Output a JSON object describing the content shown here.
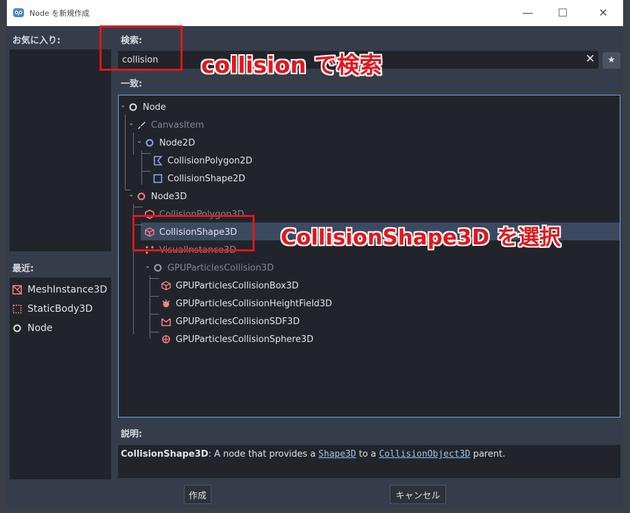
{
  "window": {
    "title": "Node を新規作成",
    "controls": {
      "minimize": "—",
      "maximize": "☐",
      "close": "✕"
    }
  },
  "favorites": {
    "label": "お気に入り:"
  },
  "recent": {
    "label": "最近:",
    "items": [
      {
        "label": "MeshInstance3D",
        "icon": "mesh-instance-icon"
      },
      {
        "label": "StaticBody3D",
        "icon": "static-body-icon"
      },
      {
        "label": "Node",
        "icon": "node-icon"
      }
    ]
  },
  "search": {
    "label": "検索:",
    "value": "collision",
    "clear": "✕",
    "favorite": "★"
  },
  "matches": {
    "label": "一致:",
    "tree": [
      {
        "label": "Node",
        "icon": "node-icon",
        "dim": false
      },
      {
        "label": "CanvasItem",
        "icon": "canvas-item-icon",
        "dim": true
      },
      {
        "label": "Node2D",
        "icon": "node2d-icon",
        "dim": false
      },
      {
        "label": "CollisionPolygon2D",
        "icon": "collision-polygon-2d-icon",
        "dim": false
      },
      {
        "label": "CollisionShape2D",
        "icon": "collision-shape-2d-icon",
        "dim": false
      },
      {
        "label": "Node3D",
        "icon": "node3d-icon",
        "dim": false
      },
      {
        "label": "CollisionPolygon3D",
        "icon": "collision-polygon-3d-icon",
        "dim": false
      },
      {
        "label": "CollisionShape3D",
        "icon": "collision-shape-3d-icon",
        "dim": false,
        "selected": true
      },
      {
        "label": "VisualInstance3D",
        "icon": "visual-instance-icon",
        "dim": true
      },
      {
        "label": "GPUParticlesCollision3D",
        "icon": "gpu-particles-collision-icon",
        "dim": true
      },
      {
        "label": "GPUParticlesCollisionBox3D",
        "icon": "gpu-particles-collision-box-icon",
        "dim": false
      },
      {
        "label": "GPUParticlesCollisionHeightField3D",
        "icon": "gpu-particles-collision-heightfield-icon",
        "dim": false
      },
      {
        "label": "GPUParticlesCollisionSDF3D",
        "icon": "gpu-particles-collision-sdf-icon",
        "dim": false
      },
      {
        "label": "GPUParticlesCollisionSphere3D",
        "icon": "gpu-particles-collision-sphere-icon",
        "dim": false
      }
    ]
  },
  "description": {
    "label": "説明:",
    "class_name": "CollisionShape3D",
    "text_1": ": A node that provides a ",
    "link_1": "Shape3D",
    "text_2": " to a ",
    "link_2": "CollisionObject3D",
    "text_3": " parent."
  },
  "buttons": {
    "create": "作成",
    "cancel": "キャンセル"
  },
  "annotations": {
    "search_note": "collision で検索",
    "select_note": "CollisionShape3D を選択"
  },
  "colors": {
    "accent_red": "#e4161d",
    "node2d_blue": "#8da5f3",
    "node3d_red": "#fc7f7f",
    "tree_border": "#6aa8e8"
  }
}
